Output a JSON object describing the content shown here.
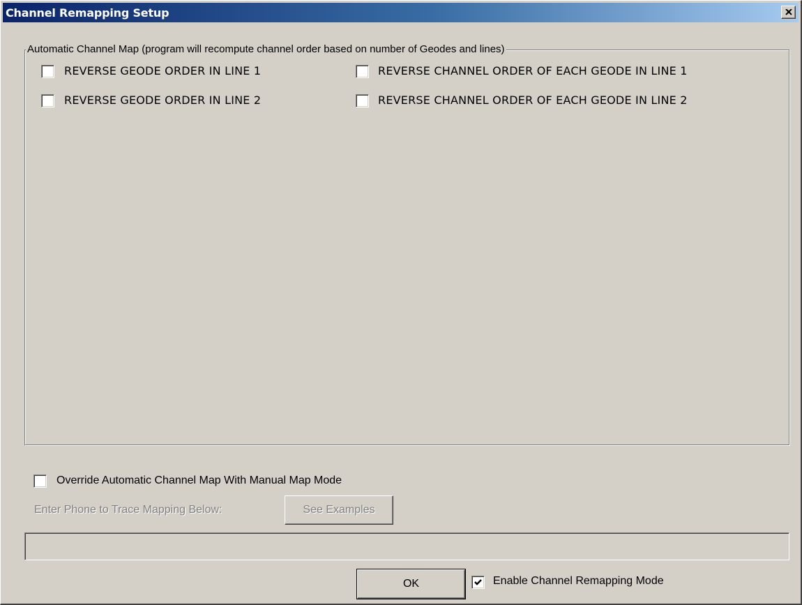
{
  "window": {
    "title": "Channel Remapping Setup"
  },
  "auto_map": {
    "group_label": "Automatic Channel Map (program will recompute channel order based on number of Geodes and lines)",
    "options": [
      {
        "label": "REVERSE GEODE ORDER IN LINE 1",
        "checked": false
      },
      {
        "label": "REVERSE CHANNEL ORDER OF EACH GEODE IN LINE 1",
        "checked": false
      },
      {
        "label": "REVERSE GEODE ORDER IN LINE 2",
        "checked": false
      },
      {
        "label": "REVERSE CHANNEL ORDER OF EACH GEODE IN LINE 2",
        "checked": false
      }
    ]
  },
  "manual_map": {
    "override_label": "Override Automatic Channel Map With Manual Map Mode",
    "override_checked": false,
    "enter_label": "Enter Phone to Trace Mapping Below:",
    "examples_button": "See Examples",
    "mapping_value": ""
  },
  "footer": {
    "ok_label": "OK",
    "enable_label": "Enable Channel Remapping Mode",
    "enable_checked": true
  },
  "icons": {
    "close": "close-icon",
    "check": "checkmark-icon"
  },
  "colors": {
    "title_start": "#0a246a",
    "title_end": "#a6caf0",
    "face": "#d4d0c8"
  }
}
